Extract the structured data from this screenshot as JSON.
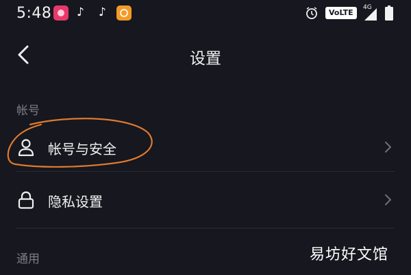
{
  "status_bar": {
    "time": "5:48",
    "volte": "VoLTE",
    "network": "4G",
    "icons": [
      "app-icon",
      "tiktok-icon",
      "tiktok-icon",
      "uc-browser-icon",
      "alarm-icon",
      "signal-icon",
      "battery-icon"
    ]
  },
  "nav": {
    "title": "设置",
    "back_icon": "chevron-left-icon"
  },
  "sections": [
    {
      "header": "帐号",
      "items": [
        {
          "label": "帐号与安全",
          "icon": "user-icon"
        },
        {
          "label": "隐私设置",
          "icon": "lock-icon"
        }
      ]
    },
    {
      "header": "通用",
      "items": []
    }
  ],
  "annotation_color": "#e07a2e",
  "watermark": "易坊好文馆"
}
